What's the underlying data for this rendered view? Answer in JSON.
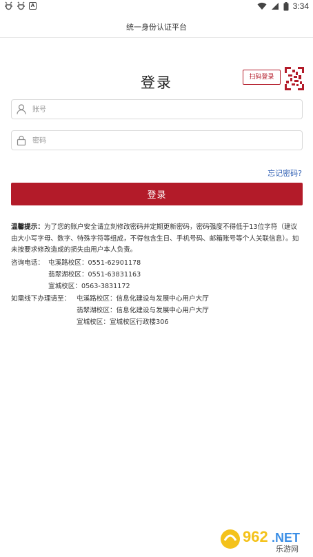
{
  "status_bar": {
    "time": "3:34",
    "notification_icons": [
      "bug-icon",
      "bug-icon",
      "a-square-icon"
    ],
    "system_icons": [
      "wifi-icon",
      "signal-icon",
      "battery-icon"
    ]
  },
  "app_bar": {
    "title": "统一身份认证平台"
  },
  "login": {
    "title": "登录",
    "qr_label": "扫码登录",
    "account_placeholder": "账号",
    "password_placeholder": "密码",
    "forgot_label": "忘记密码?",
    "submit_label": "登录"
  },
  "notice": {
    "label": "温馨提示：",
    "text": "为了您的账户安全请立刻修改密码并定期更新密码，密码强度不得低于13位字符（建议由大小写字母、数字、特殊字符等组成，不得包含生日、手机号码、邮箱账号等个人关联信息）。如未按要求修改造成的损失由用户本人负责。"
  },
  "consult": {
    "label": "咨询电话：",
    "rows": [
      "屯溪路校区：0551-62901178",
      "翡翠湖校区：0551-63831163",
      "宣城校区：0563-3831172"
    ]
  },
  "offline": {
    "label": "如需线下办理请至：",
    "rows": [
      "屯溪路校区：信息化建设与发展中心用户大厅",
      "翡翠湖校区：信息化建设与发展中心用户大厅",
      "宣城校区：宣城校区行政楼306"
    ]
  },
  "watermark": {
    "brand_number": "962",
    "brand_suffix": ".NET",
    "brand_cn": "乐游网"
  },
  "colors": {
    "accent": "#b31b29",
    "link": "#2f5fb3",
    "border": "#d9d9d9"
  }
}
